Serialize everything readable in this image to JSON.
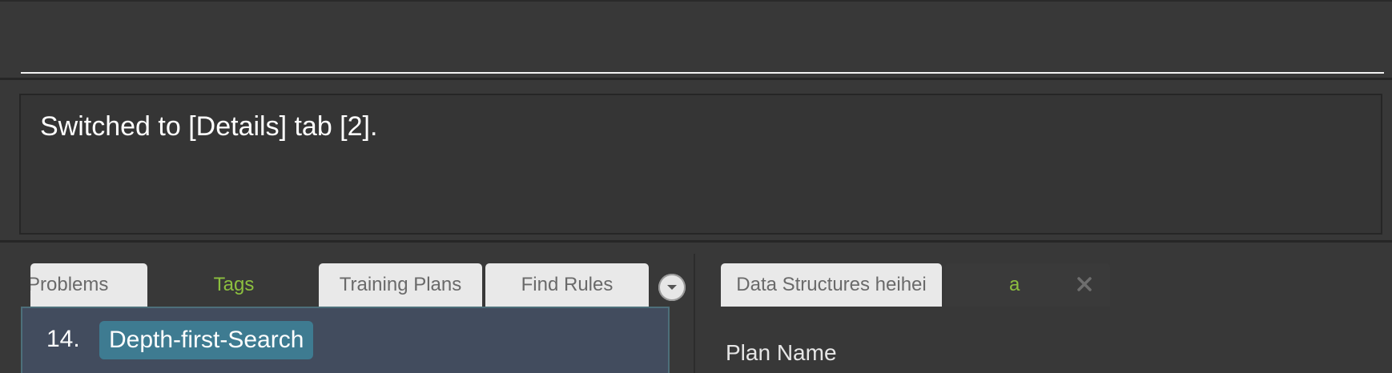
{
  "command_box": {
    "value": "",
    "placeholder": ""
  },
  "result_display": {
    "text": "Switched to [Details] tab [2]."
  },
  "left_panel": {
    "tabs": [
      {
        "label": "Problems",
        "state": "inactive"
      },
      {
        "label": "Tags",
        "state": "selected"
      },
      {
        "label": "Training Plans",
        "state": "inactive"
      },
      {
        "label": "Find Rules",
        "state": "inactive"
      }
    ],
    "overflow_icon": "chevron-down-icon",
    "list": [
      {
        "index": "14.",
        "tag": "Depth-first-Search"
      }
    ]
  },
  "right_panel": {
    "tabs": [
      {
        "label": "Data Structures heihei",
        "state": "inactive"
      },
      {
        "label": "a",
        "state": "selected",
        "closable": true
      }
    ],
    "close_icon": "close-icon",
    "plan_name_label": "Plan Name"
  },
  "colors": {
    "background": "#383838",
    "selected_tab_text": "#8cbf3f",
    "tag_chip": "#3e7b91",
    "list_item_bg": "#424c5e"
  }
}
